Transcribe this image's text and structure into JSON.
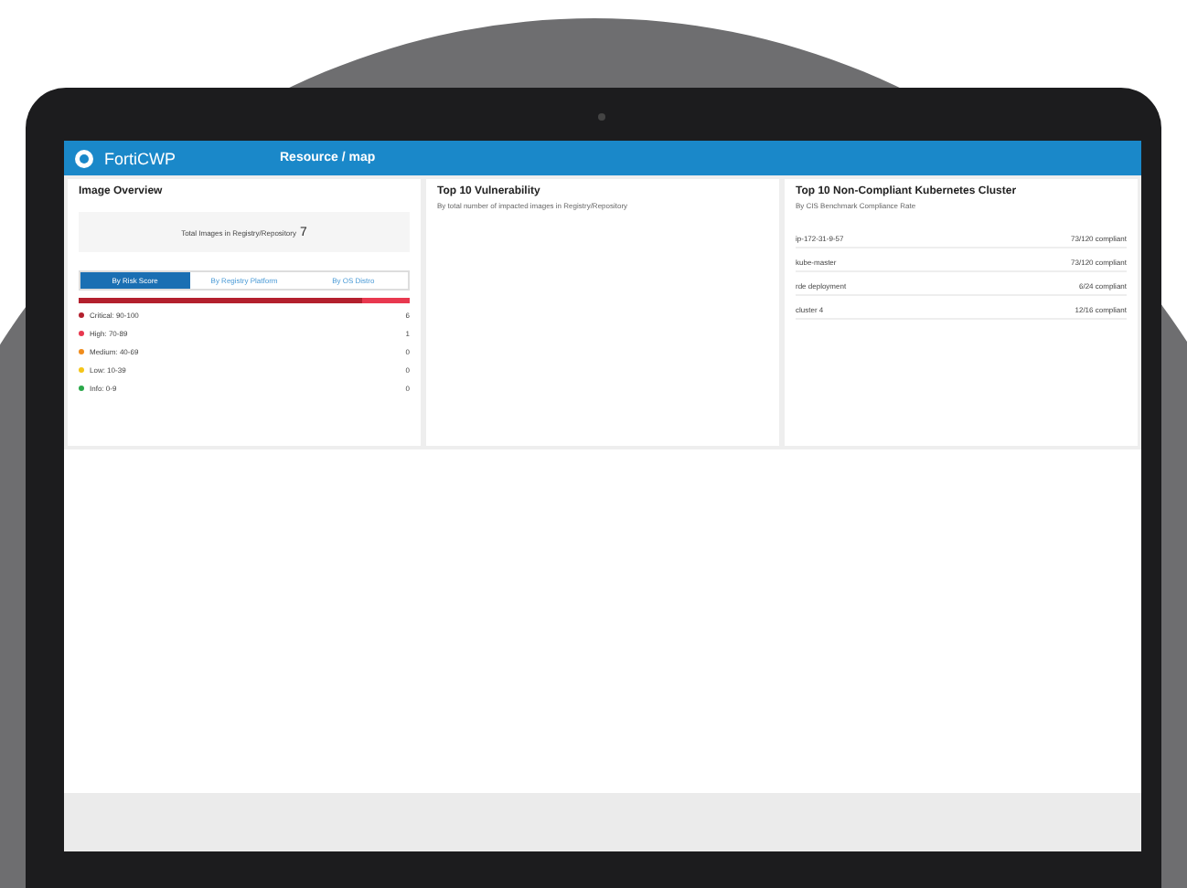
{
  "header": {
    "brand": "FortiCWP",
    "breadcrumb": "Resource / map"
  },
  "image_overview": {
    "title": "Image Overview",
    "total_label": "Total Images in Registry/Repository",
    "total": "7",
    "tabs": [
      {
        "label": "By Risk Score",
        "selected": true
      },
      {
        "label": "By Registry Platform",
        "selected": false
      },
      {
        "label": "By OS Distro",
        "selected": false
      }
    ],
    "risks": [
      {
        "label": "Critical: 90-100",
        "count": "6",
        "color": "#b3202e"
      },
      {
        "label": "High: 70-89",
        "count": "1",
        "color": "#e8384f"
      },
      {
        "label": "Medium: 40-69",
        "count": "0",
        "color": "#f08c1c"
      },
      {
        "label": "Low: 10-39",
        "count": "0",
        "color": "#f5c518"
      },
      {
        "label": "Info: 0-9",
        "count": "0",
        "color": "#2aa84a"
      }
    ]
  },
  "vulnerability": {
    "title": "Top 10 Vulnerability",
    "subtitle": "By total number of impacted images in Registry/Repository"
  },
  "clusters": {
    "title": "Top 10 Non-Compliant Kubernetes Cluster",
    "subtitle": "By CIS Benchmark Compliance Rate",
    "rows": [
      {
        "name": "ip-172-31-9-57",
        "value": "73/120 compliant"
      },
      {
        "name": "kube-master",
        "value": "73/120 compliant"
      },
      {
        "name": "rde deployment",
        "value": "6/24 compliant"
      },
      {
        "name": "cluster 4",
        "value": "12/16 compliant"
      }
    ]
  }
}
